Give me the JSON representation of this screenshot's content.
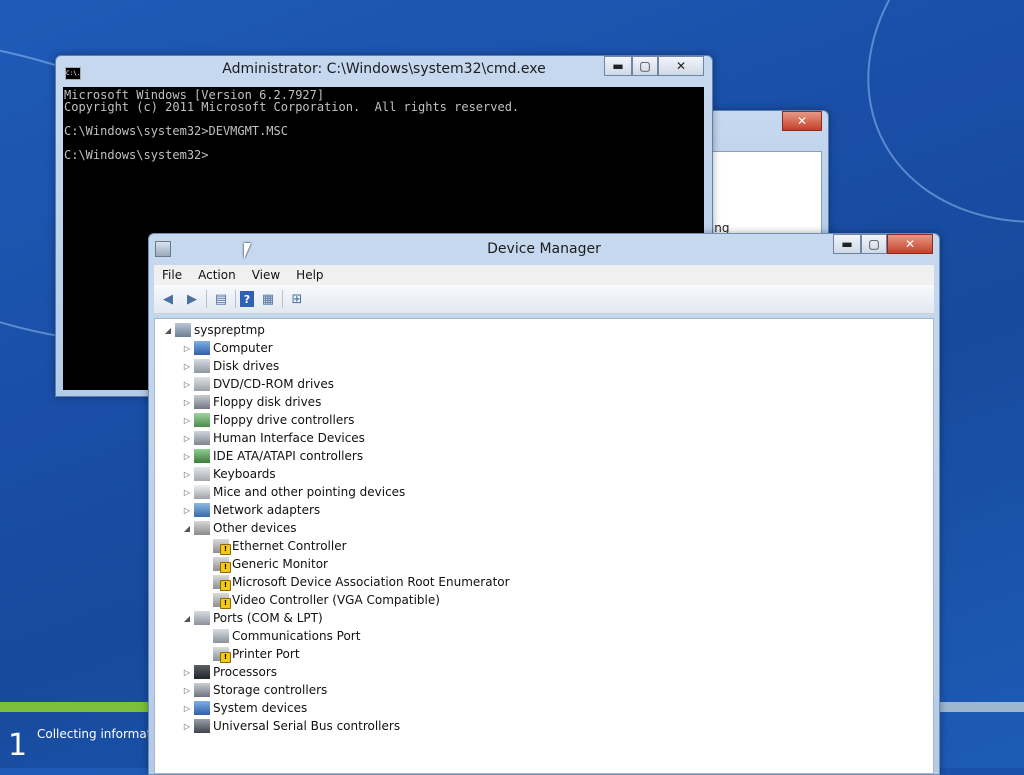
{
  "setup": {
    "step": "1",
    "status": "Collecting information"
  },
  "cmd": {
    "title": "Administrator: C:\\Windows\\system32\\cmd.exe",
    "icon_text": "C:\\.",
    "lines": [
      "Microsoft Windows [Version 6.2.7927]",
      "Copyright (c) 2011 Microsoft Corporation.  All rights reserved.",
      "",
      "C:\\Windows\\system32>DEVMGMT.MSC",
      "",
      "C:\\Windows\\system32>"
    ]
  },
  "bg_dialog": {
    "fragment": "ring"
  },
  "devmgr": {
    "title": "Device Manager",
    "menu": [
      "File",
      "Action",
      "View",
      "Help"
    ],
    "root": "syspreptmp",
    "nodes": [
      {
        "label": "Computer",
        "level": 1,
        "icon": "computer-icon"
      },
      {
        "label": "Disk drives",
        "level": 1,
        "icon": "disk-drive-icon"
      },
      {
        "label": "DVD/CD-ROM drives",
        "level": 1,
        "icon": "dvd-drive-icon"
      },
      {
        "label": "Floppy disk drives",
        "level": 1,
        "icon": "floppy-disk-icon"
      },
      {
        "label": "Floppy drive controllers",
        "level": 1,
        "icon": "floppy-controller-icon"
      },
      {
        "label": "Human Interface Devices",
        "level": 1,
        "icon": "hid-icon"
      },
      {
        "label": "IDE ATA/ATAPI controllers",
        "level": 1,
        "icon": "ide-controller-icon"
      },
      {
        "label": "Keyboards",
        "level": 1,
        "icon": "keyboard-icon"
      },
      {
        "label": "Mice and other pointing devices",
        "level": 1,
        "icon": "mouse-icon"
      },
      {
        "label": "Network adapters",
        "level": 1,
        "icon": "network-adapter-icon"
      },
      {
        "label": "Other devices",
        "level": 1,
        "icon": "unknown-device-icon",
        "expanded": true
      },
      {
        "label": "Ethernet Controller",
        "level": 2,
        "icon": "warning-device-icon"
      },
      {
        "label": "Generic Monitor",
        "level": 2,
        "icon": "warning-device-icon"
      },
      {
        "label": "Microsoft Device Association Root Enumerator",
        "level": 2,
        "icon": "warning-device-icon"
      },
      {
        "label": "Video Controller (VGA Compatible)",
        "level": 2,
        "icon": "warning-device-icon"
      },
      {
        "label": "Ports (COM & LPT)",
        "level": 1,
        "icon": "port-icon",
        "expanded": true
      },
      {
        "label": "Communications Port",
        "level": 2,
        "icon": "port-icon"
      },
      {
        "label": "Printer Port",
        "level": 2,
        "icon": "warning-port-icon"
      },
      {
        "label": "Processors",
        "level": 1,
        "icon": "processor-icon"
      },
      {
        "label": "Storage controllers",
        "level": 1,
        "icon": "storage-controller-icon"
      },
      {
        "label": "System devices",
        "level": 1,
        "icon": "system-device-icon"
      },
      {
        "label": "Universal Serial Bus controllers",
        "level": 1,
        "icon": "usb-icon"
      }
    ]
  },
  "colors": {
    "desktop": "#1a4fa8",
    "progress": "#7bbf3a",
    "console_bg": "#000000",
    "console_fg": "#c0c0c0",
    "close_btn": "#c6402b"
  }
}
